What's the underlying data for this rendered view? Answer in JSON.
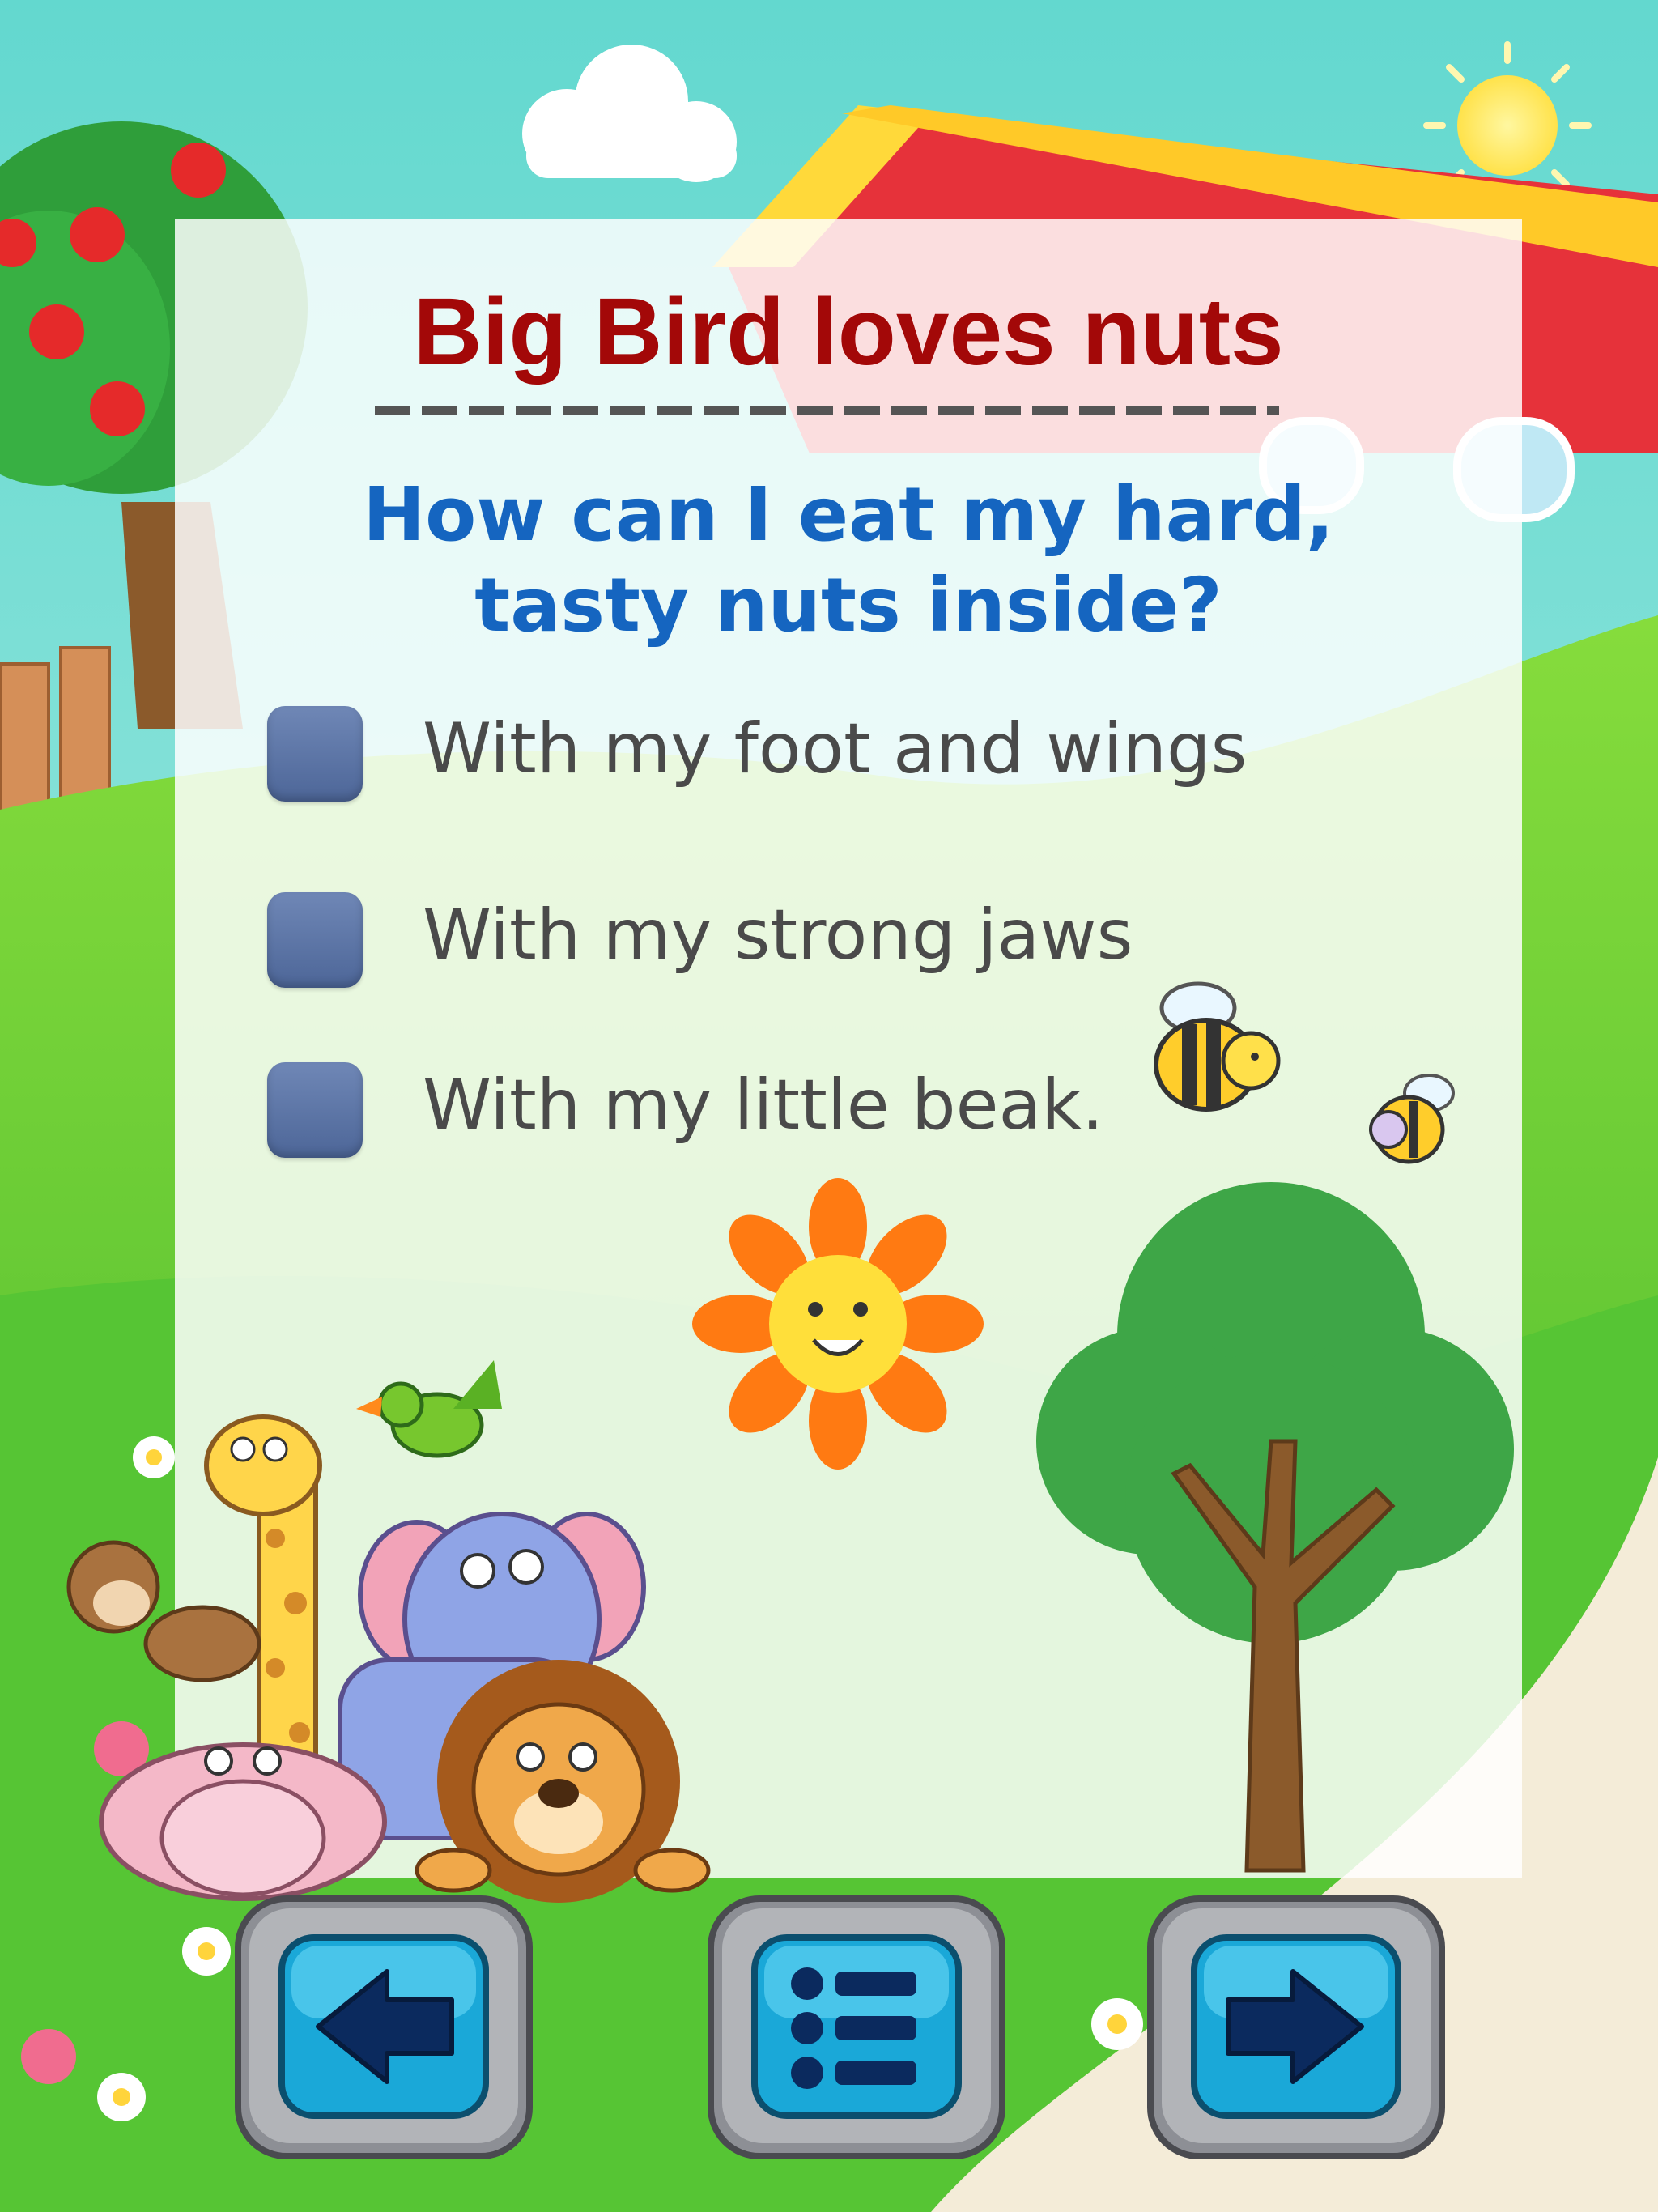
{
  "title": "Big Bird loves nuts",
  "question": {
    "line1": "How can I eat my hard,",
    "line2": "tasty nuts inside?"
  },
  "options": [
    {
      "label": "With my foot and wings",
      "checked": false
    },
    {
      "label": "With my strong jaws",
      "checked": false
    },
    {
      "label": "With my little beak.",
      "checked": false
    }
  ],
  "navigation": {
    "back_icon": "arrow-left-icon",
    "menu_icon": "list-menu-icon",
    "next_icon": "arrow-right-icon"
  },
  "colors": {
    "title": "#a30808",
    "question": "#1565c0",
    "option_text": "#4a4a4a",
    "checkbox": "#5a72a4",
    "sky": "#7fe0d8",
    "grass": "#5fc63a"
  }
}
